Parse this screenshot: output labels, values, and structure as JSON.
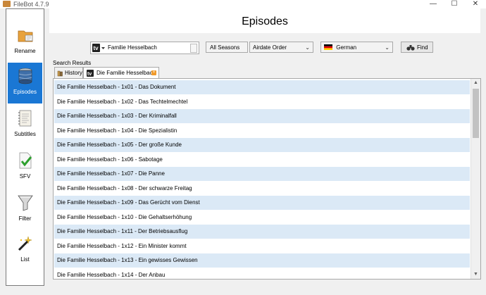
{
  "window": {
    "title": "FileBot 4.7.9",
    "controls": [
      "—",
      "☐",
      "✕"
    ]
  },
  "sidebar": {
    "items": [
      {
        "label": "Rename",
        "icon": "rename-icon",
        "active": false
      },
      {
        "label": "Episodes",
        "icon": "episodes-icon",
        "active": true
      },
      {
        "label": "Subtitles",
        "icon": "subtitles-icon",
        "active": false
      },
      {
        "label": "SFV",
        "icon": "sfv-icon",
        "active": false
      },
      {
        "label": "Filter",
        "icon": "filter-icon",
        "active": false
      },
      {
        "label": "List",
        "icon": "list-icon",
        "active": false
      }
    ]
  },
  "header": {
    "title": "Episodes"
  },
  "search": {
    "value": "Familie Hesselbach",
    "source_icon": "tv-icon"
  },
  "controls": {
    "season": "All Seasons",
    "order": "Airdate Order",
    "language": "German",
    "language_flag": "germany-flag-icon",
    "find_label": "Find"
  },
  "results": {
    "label": "Search Results",
    "tabs": [
      {
        "label": "History",
        "icon": "history-icon"
      },
      {
        "label": "Die Familie Hesselbach",
        "icon": "tv-icon",
        "active": true
      }
    ],
    "episodes": [
      "Die Familie Hesselbach - 1x01 - Das Dokument",
      "Die Familie Hesselbach - 1x02 - Das Techtelmechtel",
      "Die Familie Hesselbach - 1x03 - Der Kriminalfall",
      "Die Familie Hesselbach - 1x04 - Die Spezialistin",
      "Die Familie Hesselbach - 1x05 - Der große Kunde",
      "Die Familie Hesselbach - 1x06 - Sabotage",
      "Die Familie Hesselbach - 1x07 - Die Panne",
      "Die Familie Hesselbach - 1x08 - Der schwarze Freitag",
      "Die Familie Hesselbach - 1x09 - Das Gerücht vom Dienst",
      "Die Familie Hesselbach - 1x10 - Die Gehaltserhöhung",
      "Die Familie Hesselbach - 1x11 - Der Betriebsausflug",
      "Die Familie Hesselbach - 1x12 - Ein Minister kommt",
      "Die Familie Hesselbach - 1x13 - Ein gewisses Gewissen",
      "Die Familie Hesselbach - 1x14 - Der Anbau"
    ]
  },
  "colors": {
    "accent": "#1a77d4",
    "row_alt": "#dbe9f6"
  }
}
